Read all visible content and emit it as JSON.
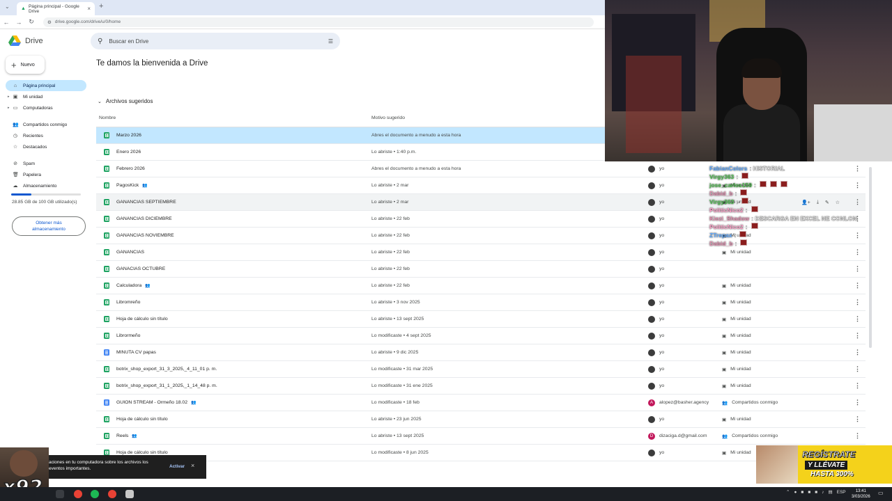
{
  "browser": {
    "tab_title": "Página principal - Google Drive",
    "url": "drive.google.com/drive/u/0/home"
  },
  "drive": {
    "logo_text": "Drive",
    "search_placeholder": "Buscar en Drive",
    "new_button": "Nuevo",
    "welcome": "Te damos la bienvenida a Drive",
    "suggested_header": "Archivos sugeridos",
    "columns": {
      "name": "Nombre",
      "reason": "Motivo sugerido"
    }
  },
  "sidebar": {
    "items": [
      {
        "label": "Página principal",
        "icon": "home-icon"
      },
      {
        "label": "Mi unidad",
        "icon": "my-drive-icon"
      },
      {
        "label": "Computadoras",
        "icon": "computer-icon"
      },
      {
        "label": "Compartidos conmigo",
        "icon": "people-icon"
      },
      {
        "label": "Recientes",
        "icon": "clock-icon"
      },
      {
        "label": "Destacados",
        "icon": "star-icon"
      },
      {
        "label": "Spam",
        "icon": "spam-icon"
      },
      {
        "label": "Papelera",
        "icon": "trash-icon"
      },
      {
        "label": "Almacenamiento",
        "icon": "cloud-icon"
      }
    ],
    "storage_text": "28.85 GB de 100 GB utilizado(s)",
    "storage_fraction": 0.2885,
    "get_more": "Obtener más almacenamiento"
  },
  "files": [
    {
      "name": "Marzo 2026",
      "type": "sheet",
      "shared": false,
      "reason": "Abres el documento a menudo a esta hora",
      "owner": "",
      "location": ""
    },
    {
      "name": "Enero 2026",
      "type": "sheet",
      "shared": false,
      "reason": "Lo abriste • 1:40 p.m.",
      "owner": "",
      "location": ""
    },
    {
      "name": "Febrero 2026",
      "type": "sheet",
      "shared": false,
      "reason": "Abres el documento a menudo a esta hora",
      "owner": "yo",
      "location": ""
    },
    {
      "name": "PagosKick",
      "type": "sheet",
      "shared": true,
      "reason": "Lo abriste • 2 mar",
      "owner": "yo",
      "location": "Mi unidad"
    },
    {
      "name": "GANANCIAS SEPTIEMBRE",
      "type": "sheet",
      "shared": false,
      "reason": "Lo abriste • 2 mar",
      "owner": "yo",
      "location": "Mi unidad"
    },
    {
      "name": "GANANCIAS DICIEMBRE",
      "type": "sheet",
      "shared": false,
      "reason": "Lo abriste • 22 feb",
      "owner": "yo",
      "location": ""
    },
    {
      "name": "GANANCIAS NOVIEMBRE",
      "type": "sheet",
      "shared": false,
      "reason": "Lo abriste • 22 feb",
      "owner": "yo",
      "location": "Mi unidad"
    },
    {
      "name": "GANANCIAS",
      "type": "sheet",
      "shared": false,
      "reason": "Lo abriste • 22 feb",
      "owner": "yo",
      "location": "Mi unidad"
    },
    {
      "name": "GANACIAS OCTUBRE",
      "type": "sheet",
      "shared": false,
      "reason": "Lo abriste • 22 feb",
      "owner": "yo",
      "location": ""
    },
    {
      "name": "Calculadora",
      "type": "sheet",
      "shared": true,
      "reason": "Lo abriste • 22 feb",
      "owner": "yo",
      "location": "Mi unidad"
    },
    {
      "name": "Libromreño",
      "type": "sheet",
      "shared": false,
      "reason": "Lo abriste • 3 nov 2025",
      "owner": "yo",
      "location": "Mi unidad"
    },
    {
      "name": "Hoja de cálculo sin título",
      "type": "sheet",
      "shared": false,
      "reason": "Lo abriste • 13 sept 2025",
      "owner": "yo",
      "location": "Mi unidad"
    },
    {
      "name": "Librormeño",
      "type": "sheet",
      "shared": false,
      "reason": "Lo modificaste • 4 sept 2025",
      "owner": "yo",
      "location": "Mi unidad"
    },
    {
      "name": "MINUTA CV papas",
      "type": "doc",
      "shared": false,
      "reason": "Lo abriste • 9 dic 2025",
      "owner": "yo",
      "location": "Mi unidad"
    },
    {
      "name": "botrix_shop_export_31_3_2025,_4_11_01 p. m.",
      "type": "sheet",
      "shared": false,
      "reason": "Lo modificaste • 31 mar 2025",
      "owner": "yo",
      "location": "Mi unidad"
    },
    {
      "name": "botrix_shop_export_31_1_2025,_1_14_48 p. m.",
      "type": "sheet",
      "shared": false,
      "reason": "Lo modificaste • 31 ene 2025",
      "owner": "yo",
      "location": "Mi unidad"
    },
    {
      "name": "GUION STREAM - Ormeño 18.02",
      "type": "doc",
      "shared": true,
      "reason": "Lo modificaste • 18 feb",
      "owner": "alopez@basher.agency",
      "avatar": "A",
      "location": "Compartidos conmigo"
    },
    {
      "name": "Hoja de cálculo sin título",
      "type": "sheet",
      "shared": false,
      "reason": "Lo abriste • 23 jun 2025",
      "owner": "yo",
      "location": "Mi unidad"
    },
    {
      "name": "Reels",
      "type": "sheet",
      "shared": true,
      "reason": "Lo abriste • 13 sept 2025",
      "owner": "dizaciga.d@gmail.com",
      "avatar": "D",
      "location": "Compartidos conmigo"
    },
    {
      "name": "Hoja de cálculo sin título",
      "type": "sheet",
      "shared": false,
      "reason": "Lo modificaste • 8 jun 2025",
      "owner": "yo",
      "location": "Mi unidad"
    }
  ],
  "chat": [
    {
      "user": "FabianColors",
      "color": "#5da9ff",
      "text": ": HISTORIAL",
      "emotes": 0
    },
    {
      "user": "Virgy363",
      "color": "#4fc04f",
      "text": ":",
      "emotes": 1
    },
    {
      "user": "jose_carlos159",
      "color": "#4fc04f",
      "text": ":",
      "emotes": 3
    },
    {
      "user": "Dabid_b",
      "color": "#e58fb0",
      "text": ":",
      "emotes": 1
    },
    {
      "user": "Virgy363",
      "color": "#4fc04f",
      "text": ":",
      "emotes": 1
    },
    {
      "user": "PoliticNico2",
      "color": "#ff9ec7",
      "text": ":",
      "emotes": 1
    },
    {
      "user": "Kiezi_Shadow",
      "color": "#e58fb0",
      "text": ": DESCARGA EN EXCEL NE CONLON",
      "emotes": 0
    },
    {
      "user": "PoliticNico2",
      "color": "#ff9ec7",
      "text": ":",
      "emotes": 1
    },
    {
      "user": "ZTrepax",
      "color": "#5da9ff",
      "text": ":",
      "emotes": 1
    },
    {
      "user": "Dabid_b",
      "color": "#e58fb0",
      "text": ":",
      "emotes": 1
    }
  ],
  "toast": {
    "text": "aciones en tu computadora sobre los archivos los eventos importantes.",
    "action": "Activar"
  },
  "overlay": {
    "multiplier": "x92",
    "promo_line1": "REGÍSTRATE",
    "promo_line2": "Y LLÉVATE",
    "promo_line3": "HASTA 300%"
  },
  "taskbar": {
    "lang": "ESP",
    "time": "13:41",
    "date": "3/03/2026"
  }
}
